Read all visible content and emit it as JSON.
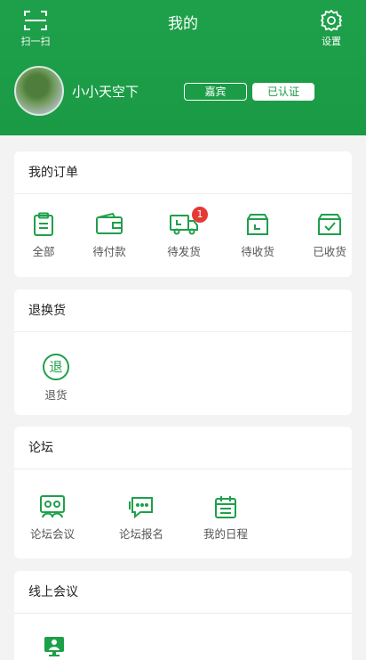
{
  "header": {
    "scan_label": "扫一扫",
    "title": "我的",
    "settings_label": "设置",
    "username": "小小天空下",
    "badge_level": "嘉宾",
    "badge_status": "已认证"
  },
  "orders": {
    "title": "我的订单",
    "items": [
      {
        "label": "全部",
        "icon": "clipboard-icon"
      },
      {
        "label": "待付款",
        "icon": "wallet-icon"
      },
      {
        "label": "待发货",
        "icon": "truck-icon",
        "badge": "1"
      },
      {
        "label": "待收货",
        "icon": "box-icon"
      },
      {
        "label": "已收货",
        "icon": "received-box-icon"
      }
    ]
  },
  "returns": {
    "title": "退换货",
    "item": {
      "label": "退货",
      "icon_text": "退"
    }
  },
  "forum": {
    "title": "论坛",
    "items": [
      {
        "label": "论坛会议",
        "icon": "group-meeting-icon"
      },
      {
        "label": "论坛报名",
        "icon": "chat-signup-icon"
      },
      {
        "label": "我的日程",
        "icon": "calendar-icon"
      }
    ]
  },
  "online": {
    "title": "线上会议",
    "items": [
      {
        "icon": "video-meeting-icon"
      }
    ]
  },
  "colors": {
    "brand": "#1ea04a",
    "badge": "#e53935"
  }
}
